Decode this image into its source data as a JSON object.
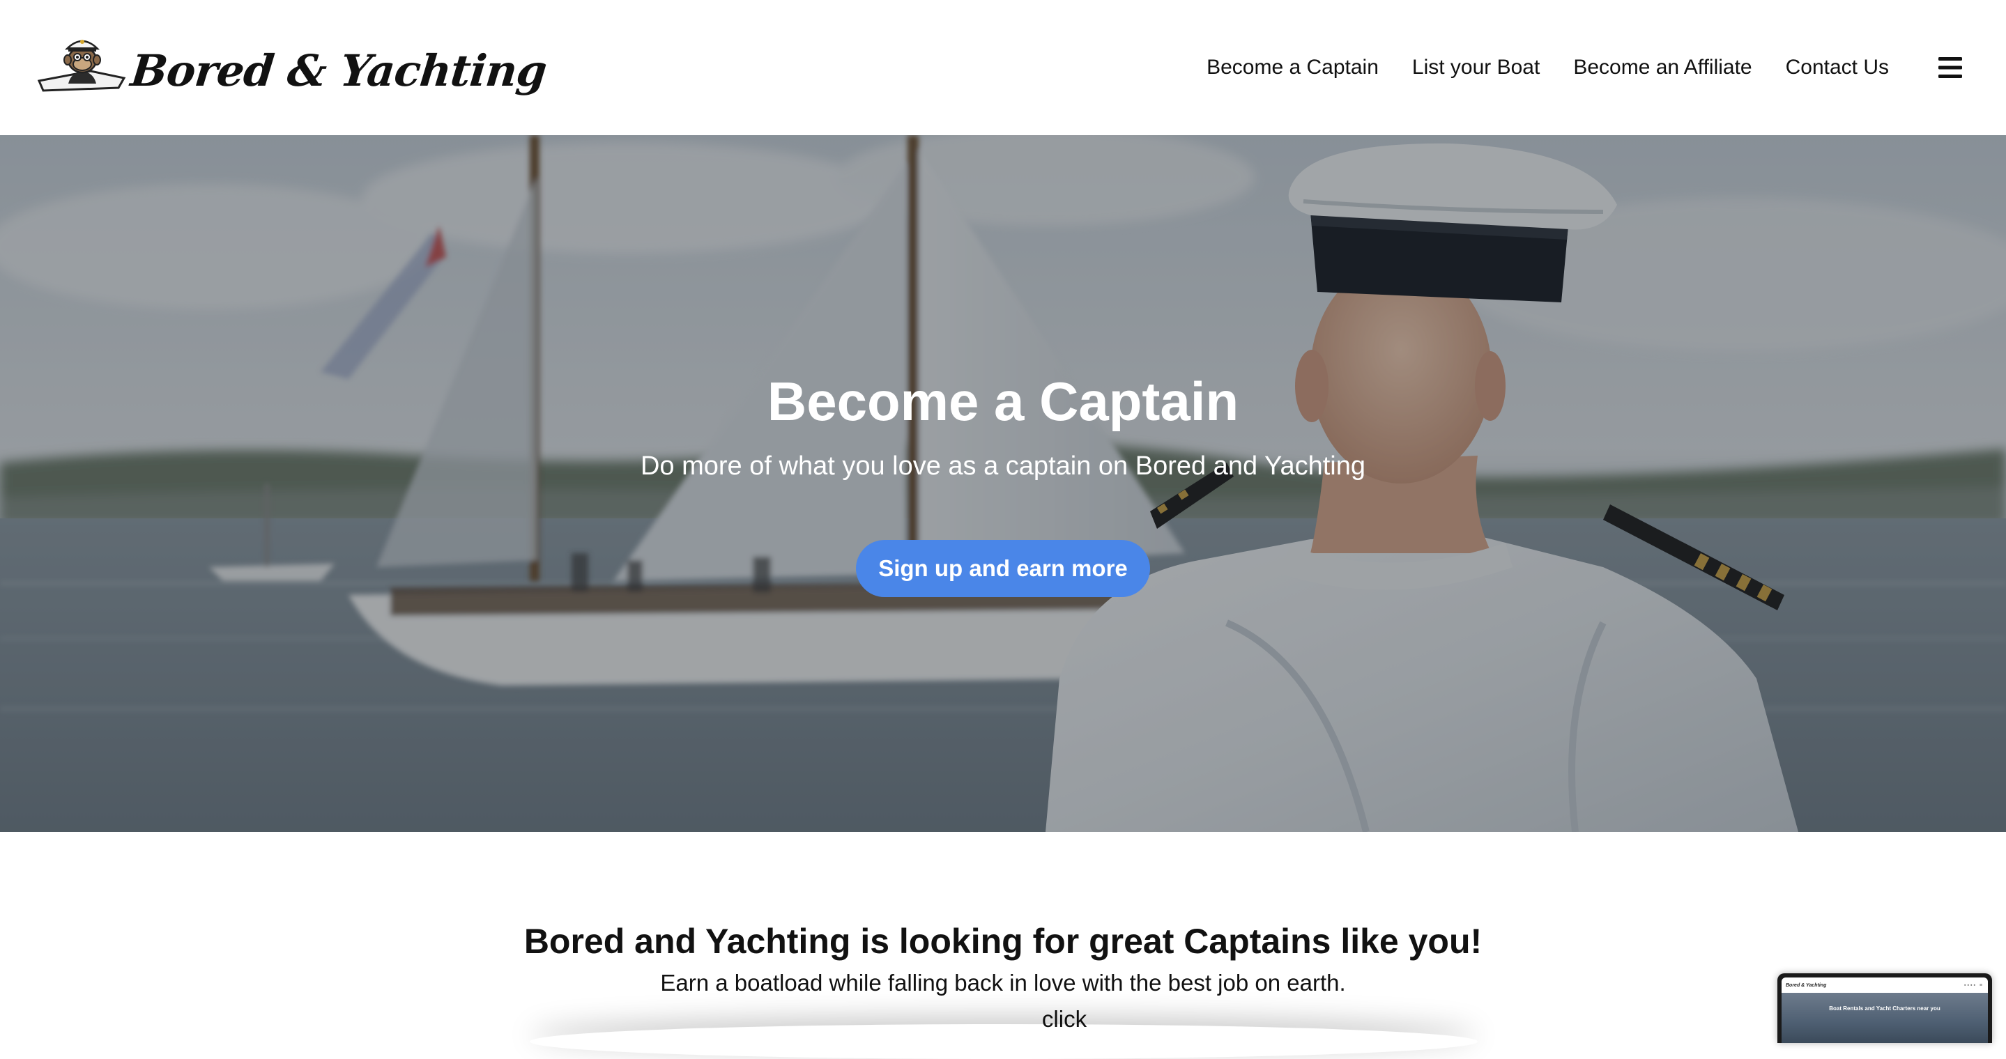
{
  "header": {
    "brand_name": "Bored & Yachting",
    "logo_icon": "captain-ape-logo-icon",
    "nav": [
      {
        "label": "Become a Captain"
      },
      {
        "label": "List your Boat"
      },
      {
        "label": "Become an Affiliate"
      },
      {
        "label": "Contact Us"
      }
    ],
    "menu_icon": "hamburger-menu-icon"
  },
  "hero": {
    "title": "Become a Captain",
    "subtitle": "Do more of what you love as a captain on Bored and Yachting",
    "cta_label": "Sign up and earn more",
    "cta_color": "#4a86e8",
    "background_image": "captain-and-sailboat-photo"
  },
  "intro": {
    "title": "Bored and Yachting is looking for great Captains like you!",
    "text": "Earn a boatload while falling back in love with the best job on earth.",
    "click_text": "click"
  },
  "preview": {
    "brand_name": "Bored & Yachting",
    "hero_title": "Boat Rentals and Yacht Charters near you"
  }
}
